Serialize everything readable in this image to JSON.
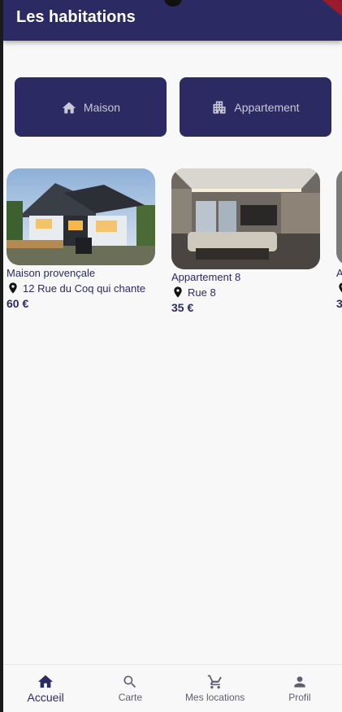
{
  "app": {
    "title": "Les habitations"
  },
  "types": [
    {
      "label": "Maison",
      "icon": "home-icon"
    },
    {
      "label": "Appartement",
      "icon": "apartment-icon"
    }
  ],
  "listings": [
    {
      "name": "Maison provençale",
      "address": "12 Rue du Coq qui chante",
      "price": "60 €"
    },
    {
      "name": "Appartement 8",
      "address": "Rue 8",
      "price": "35 €"
    },
    {
      "name": "A",
      "address": "",
      "price": "3"
    }
  ],
  "nav": [
    {
      "label": "Accueil",
      "icon": "home-icon",
      "active": true
    },
    {
      "label": "Carte",
      "icon": "search-icon",
      "active": false
    },
    {
      "label": "Mes locations",
      "icon": "cart-icon",
      "active": false
    },
    {
      "label": "Profil",
      "icon": "person-icon",
      "active": false
    }
  ],
  "colors": {
    "primary": "#2b2a63",
    "background": "#f8f8f8"
  }
}
